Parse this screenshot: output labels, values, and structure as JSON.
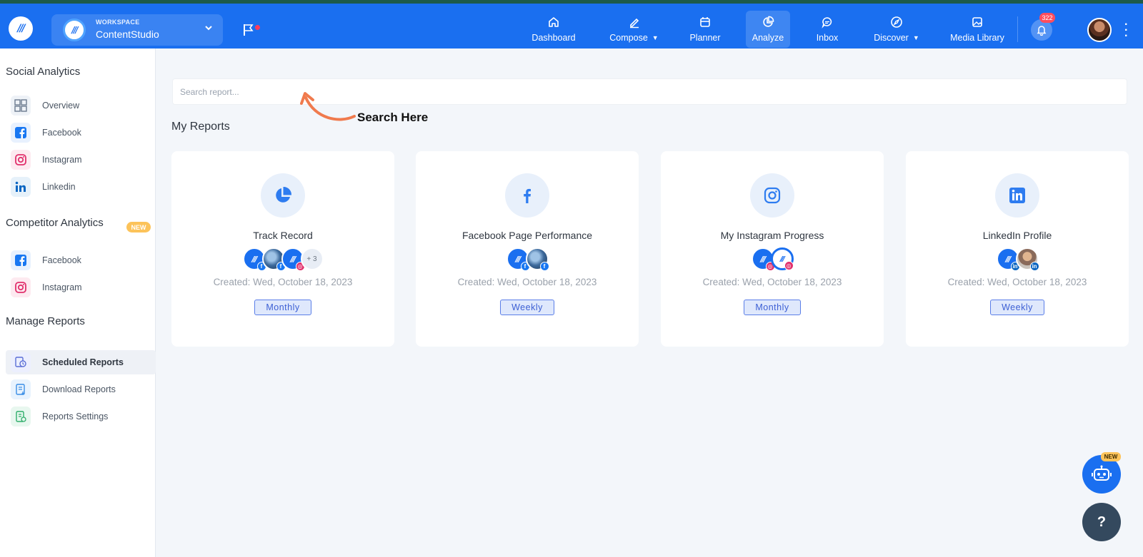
{
  "workspace": {
    "label": "WORKSPACE",
    "name": "ContentStudio"
  },
  "nav": {
    "dashboard": "Dashboard",
    "compose": "Compose",
    "planner": "Planner",
    "analyze": "Analyze",
    "inbox": "Inbox",
    "discover": "Discover",
    "media_library": "Media Library"
  },
  "notifications": {
    "count": "322"
  },
  "sidebar": {
    "social_heading": "Social Analytics",
    "social_items": [
      "Overview",
      "Facebook",
      "Instagram",
      "Linkedin"
    ],
    "competitor_heading": "Competitor Analytics",
    "competitor_badge": "NEW",
    "competitor_items": [
      "Facebook",
      "Instagram"
    ],
    "manage_heading": "Manage Reports",
    "manage_items": [
      "Scheduled Reports",
      "Download Reports",
      "Reports Settings"
    ],
    "active_item": "Scheduled Reports"
  },
  "search": {
    "placeholder": "Search report...",
    "value": ""
  },
  "annotation": {
    "text": "Search Here"
  },
  "reports": {
    "title": "My Reports",
    "cards": [
      {
        "icon": "pie-chart-icon",
        "title": "Track Record",
        "accounts_more": "+ 3",
        "created": "Created: Wed, October 18, 2023",
        "frequency": "Monthly"
      },
      {
        "icon": "facebook-icon",
        "title": "Facebook Page Performance",
        "created": "Created: Wed, October 18, 2023",
        "frequency": "Weekly"
      },
      {
        "icon": "instagram-icon",
        "title": "My Instagram Progress",
        "created": "Created: Wed, October 18, 2023",
        "frequency": "Monthly"
      },
      {
        "icon": "linkedin-icon",
        "title": "LinkedIn Profile",
        "created": "Created: Wed, October 18, 2023",
        "frequency": "Weekly"
      }
    ]
  },
  "chatbot": {
    "badge": "NEW"
  },
  "help": {
    "label": "?"
  },
  "colors": {
    "primary": "#1a6ff0",
    "badge_yellow": "#fcc35a",
    "notification_red": "#ff4d5e",
    "page_bg": "#f3f6fa"
  }
}
